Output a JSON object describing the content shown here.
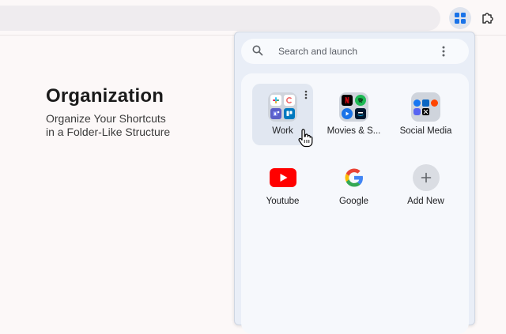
{
  "hero": {
    "title": "Organization",
    "subtitle_line1": "Organize Your Shortcuts",
    "subtitle_line2": "in a Folder-Like Structure"
  },
  "popup": {
    "search_placeholder": "Search and launch",
    "tiles": [
      {
        "label": "Work",
        "kind": "folder",
        "icons": [
          "slack-icon",
          "asana-icon",
          "teams-icon",
          "trello-icon"
        ]
      },
      {
        "label": "Movies & S...",
        "kind": "folder",
        "icons": [
          "netflix-icon",
          "spotify-icon",
          "play-icon",
          "prime-video-icon"
        ]
      },
      {
        "label": "Social Media",
        "kind": "folder",
        "icons": [
          "facebook-icon",
          "linkedin-icon",
          "reddit-icon",
          "discord-icon",
          "x-icon"
        ]
      },
      {
        "label": "Youtube",
        "kind": "link",
        "icon": "youtube-icon"
      },
      {
        "label": "Google",
        "kind": "link",
        "icon": "google-icon"
      },
      {
        "label": "Add New",
        "kind": "action",
        "icon": "plus-icon"
      }
    ]
  },
  "colors": {
    "page_bg": "#fcf8f8",
    "popup_bg": "#e9eef7",
    "youtube_red": "#ff0000",
    "netflix_red": "#e50914",
    "spotify_green": "#1db954",
    "accent_blue": "#1a73e8"
  }
}
